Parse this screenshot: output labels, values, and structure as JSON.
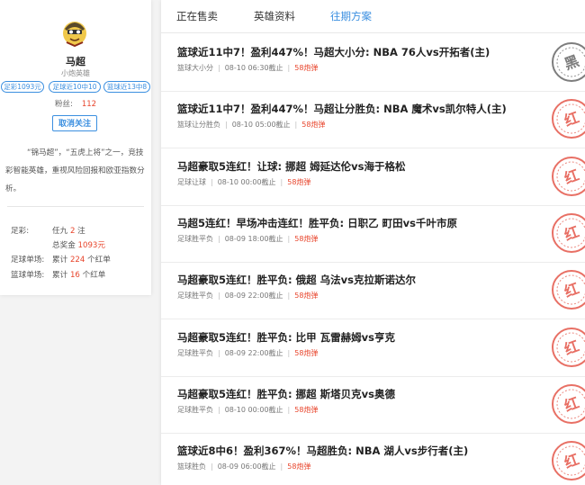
{
  "profile": {
    "name": "马超",
    "subtitle": "小炮英雄",
    "badges": [
      "足彩1093元",
      "足球近10中10",
      "篮球近13中8"
    ],
    "fans_label": "粉丝:",
    "fans_count": "112",
    "follow_label": "取消关注",
    "bio": "“锦马超”，“五虎上将”之一，竞技彩智能英雄，重视风险回报和欧亚指数分析。",
    "stats": {
      "soccer_label": "足彩:",
      "soccer_line1_pre": "任九",
      "soccer_line1_num": "2",
      "soccer_line1_post": "注",
      "soccer_line2_pre": "总奖金",
      "soccer_line2_num": "1093元",
      "football_label": "足球单场:",
      "football_pre": "累计",
      "football_num": "224",
      "football_post": "个红单",
      "basketball_label": "篮球单场:",
      "basketball_pre": "累计",
      "basketball_num": "16",
      "basketball_post": "个红单"
    }
  },
  "tabs": [
    {
      "label": "正在售卖",
      "active": false
    },
    {
      "label": "英雄资料",
      "active": false
    },
    {
      "label": "往期方案",
      "active": true
    }
  ],
  "items": [
    {
      "title": "篮球近11中7！盈利447%！马超大小分: NBA 76人vs开拓者(主)",
      "category": "篮球大小分",
      "time": "08-10 06:30截止",
      "price": "58炮弹",
      "result": "黑"
    },
    {
      "title": "篮球近11中7！盈利447%！马超让分胜负: NBA 魔术vs凯尔特人(主)",
      "category": "篮球让分胜负",
      "time": "08-10 05:00截止",
      "price": "58炮弹",
      "result": "红"
    },
    {
      "title": "马超豪取5连红！让球: 挪超 姆延达伦vs海于格松",
      "category": "足球让球",
      "time": "08-10 00:00截止",
      "price": "58炮弹",
      "result": "红"
    },
    {
      "title": "马超5连红！早场冲击连红！胜平负: 日职乙 町田vs千叶市原",
      "category": "足球胜平负",
      "time": "08-09 18:00截止",
      "price": "58炮弹",
      "result": "红"
    },
    {
      "title": "马超豪取5连红！胜平负: 俄超 乌法vs克拉斯诺达尔",
      "category": "足球胜平负",
      "time": "08-09 22:00截止",
      "price": "58炮弹",
      "result": "红"
    },
    {
      "title": "马超豪取5连红！胜平负: 比甲 瓦雷赫姆vs亨克",
      "category": "足球胜平负",
      "time": "08-09 22:00截止",
      "price": "58炮弹",
      "result": "红"
    },
    {
      "title": "马超豪取5连红！胜平负: 挪超 斯塔贝克vs奥德",
      "category": "足球胜平负",
      "time": "08-10 00:00截止",
      "price": "58炮弹",
      "result": "红"
    },
    {
      "title": "篮球近8中6！盈利367%！马超胜负: NBA 湖人vs步行者(主)",
      "category": "篮球胜负",
      "time": "08-09 06:00截止",
      "price": "58炮弹",
      "result": "红"
    }
  ],
  "colors": {
    "accent": "#3b8fe0",
    "highlight": "#e8452c",
    "stamp_red": "#e4574a",
    "stamp_black": "#666666"
  }
}
